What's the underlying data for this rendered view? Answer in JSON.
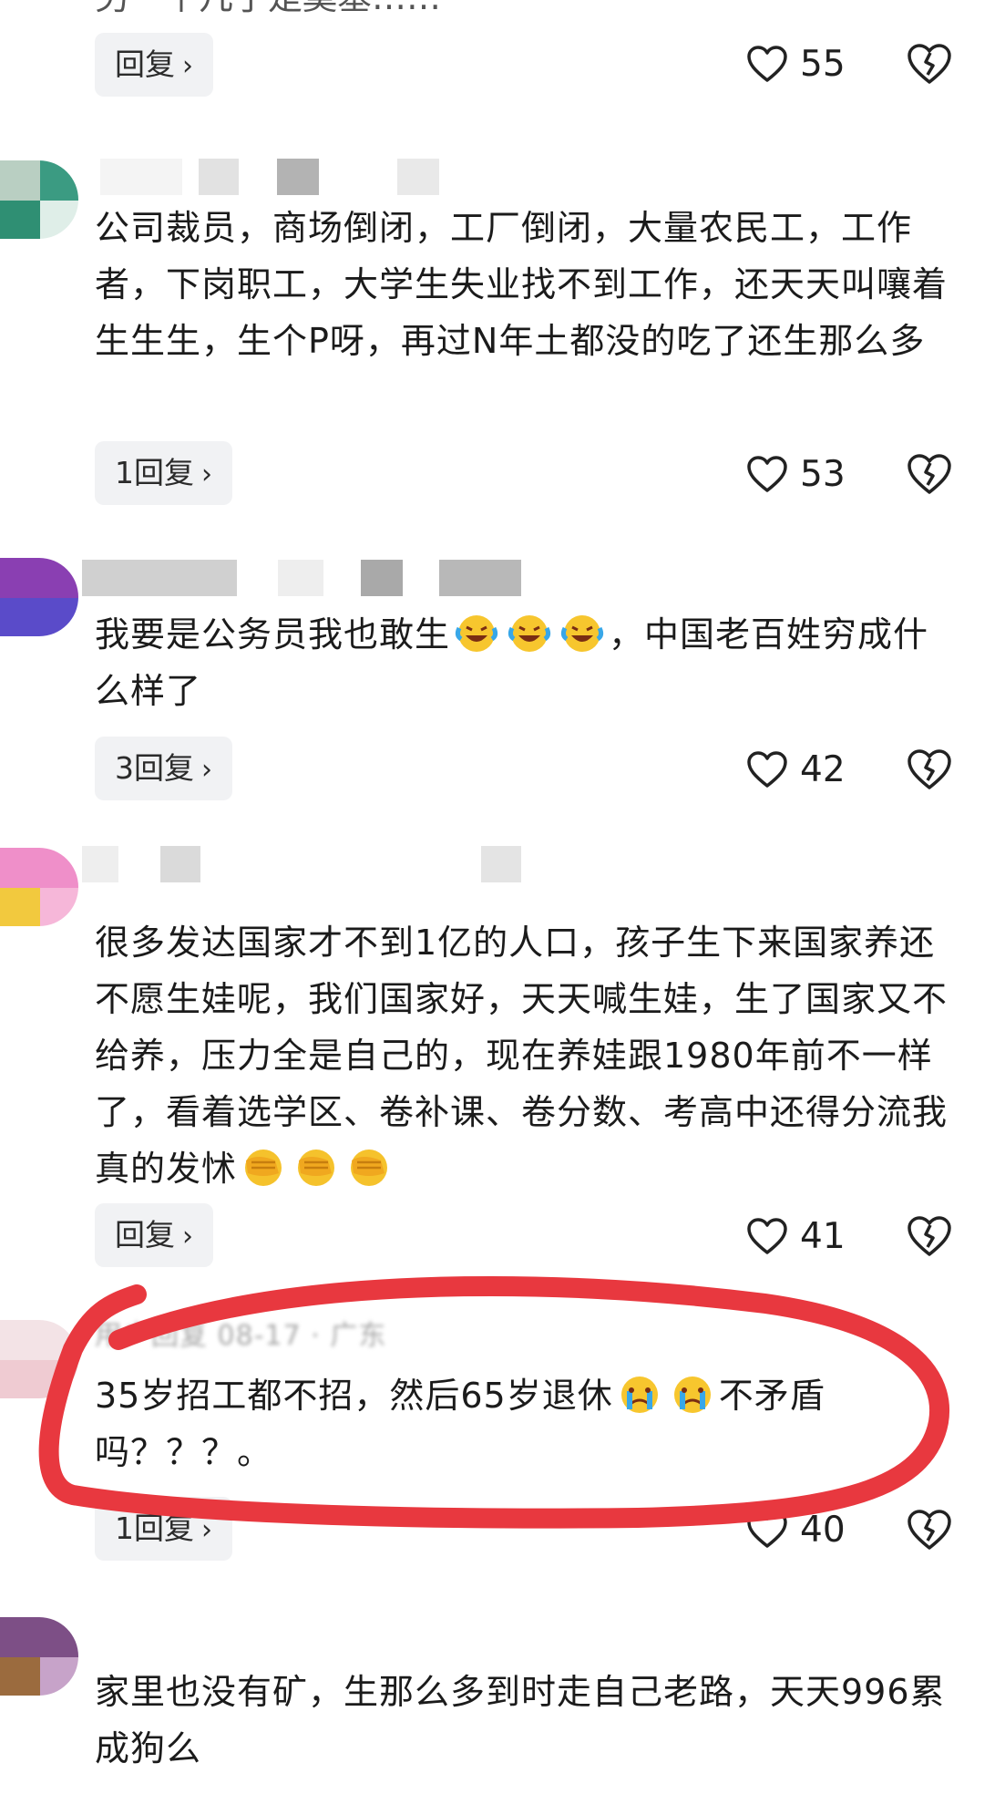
{
  "top_fragment": "另一个几乎是奠基……",
  "comments": [
    {
      "text": "",
      "reply_label": "回复",
      "likes": "55"
    },
    {
      "text": "公司裁员，商场倒闭，工厂倒闭，大量农民工，工作者，下岗职工，大学生失业找不到工作，还天天叫嚷着生生生，生个P呀，再过N年土都没的吃了还生那么多",
      "reply_label": "1回复",
      "likes": "53"
    },
    {
      "text_before_emoji": "我要是公务员我也敢生",
      "text_after_emoji": "，中国老百姓穷成什么样了",
      "emoji": "laugh-cry-emoji",
      "reply_label": "3回复",
      "likes": "42"
    },
    {
      "text": "很多发达国家才不到1亿的人口，孩子生下来国家养还不愿生娃呢，我们国家好，天天喊生娃，生了国家又不给养，压力全是自己的，现在养娃跟1980年前不一样了，看着选学区、卷补课、卷分数、考高中还得分流我真的发怵",
      "emoji": "facepalm-emoji",
      "reply_label": "回复",
      "likes": "41"
    },
    {
      "meta": "用户回复 08-17 · 广东",
      "text_before_emoji": "35岁招工都不招，然后65岁退休",
      "text_after_emoji": "不矛盾吗？？？。",
      "emoji": "crying-emoji",
      "reply_label": "1回复",
      "likes": "40"
    },
    {
      "text": "家里也没有矿，生那么多到时走自己老路，天天996累成狗么"
    }
  ],
  "colors": {
    "highlight_stroke": "#e8383f",
    "reply_bg": "#f1f2f4",
    "text": "#1b1b1b"
  },
  "icons": {
    "like": "heart-outline-icon",
    "dislike": "broken-heart-icon",
    "chevron": "chevron-right-icon"
  }
}
